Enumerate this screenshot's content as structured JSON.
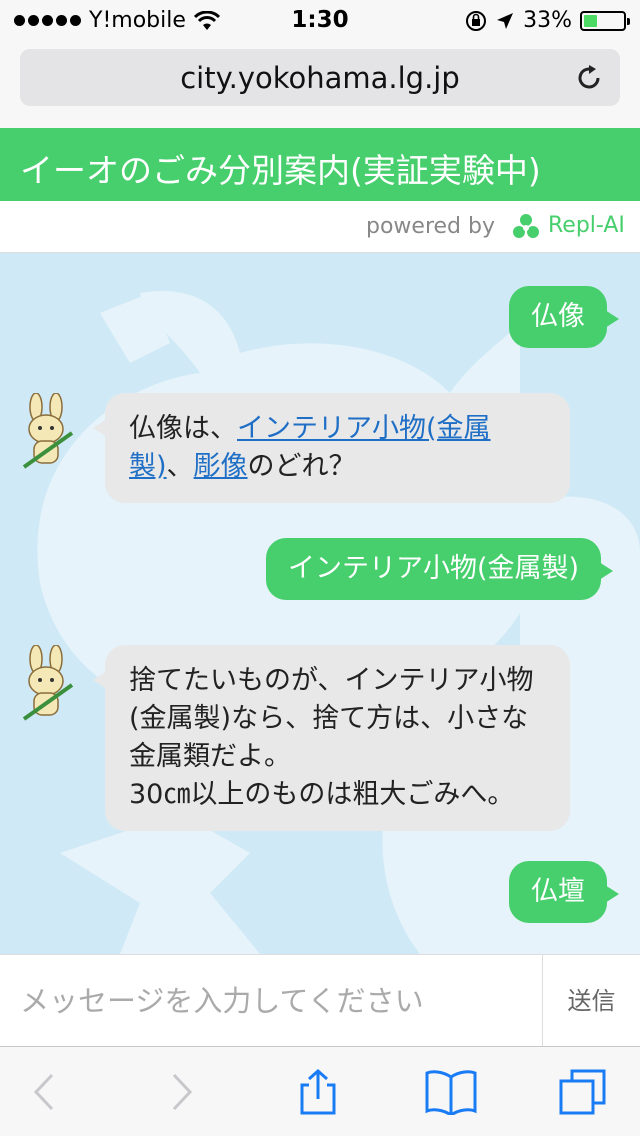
{
  "status_bar": {
    "carrier": "Y!mobile",
    "time": "1:30",
    "battery": "33%",
    "battery_level": 0.33
  },
  "browser": {
    "url": "city.yokohama.lg.jp"
  },
  "header": {
    "title": "イーオのごみ分別案内(実証実験中)"
  },
  "powered": {
    "label": "powered by",
    "brand": "Repl-AI"
  },
  "messages": {
    "m1": "仏像",
    "m2_prefix": "仏像は、",
    "m2_link1a": "インテリア小物(金属",
    "m2_link1b": "製)",
    "m2_sep": "、",
    "m2_link2": "彫像",
    "m2_suffix": "のどれ？",
    "m3": "インテリア小物(金属製)",
    "m4_line1": "捨てたいものが、インテリア小物",
    "m4_line2": "(金属製)なら、捨て方は、小さな",
    "m4_line3": "金属類だよ。",
    "m4_line4": "30㎝以上のものは粗大ごみへ。",
    "m5": "仏壇"
  },
  "input": {
    "placeholder": "メッセージを入力してください",
    "send_label": "送信"
  },
  "colors": {
    "brand_green": "#46cf6c",
    "chat_bg": "#cfeaf6",
    "link": "#1f6fc6",
    "ios_blue": "#1a7cf5"
  }
}
